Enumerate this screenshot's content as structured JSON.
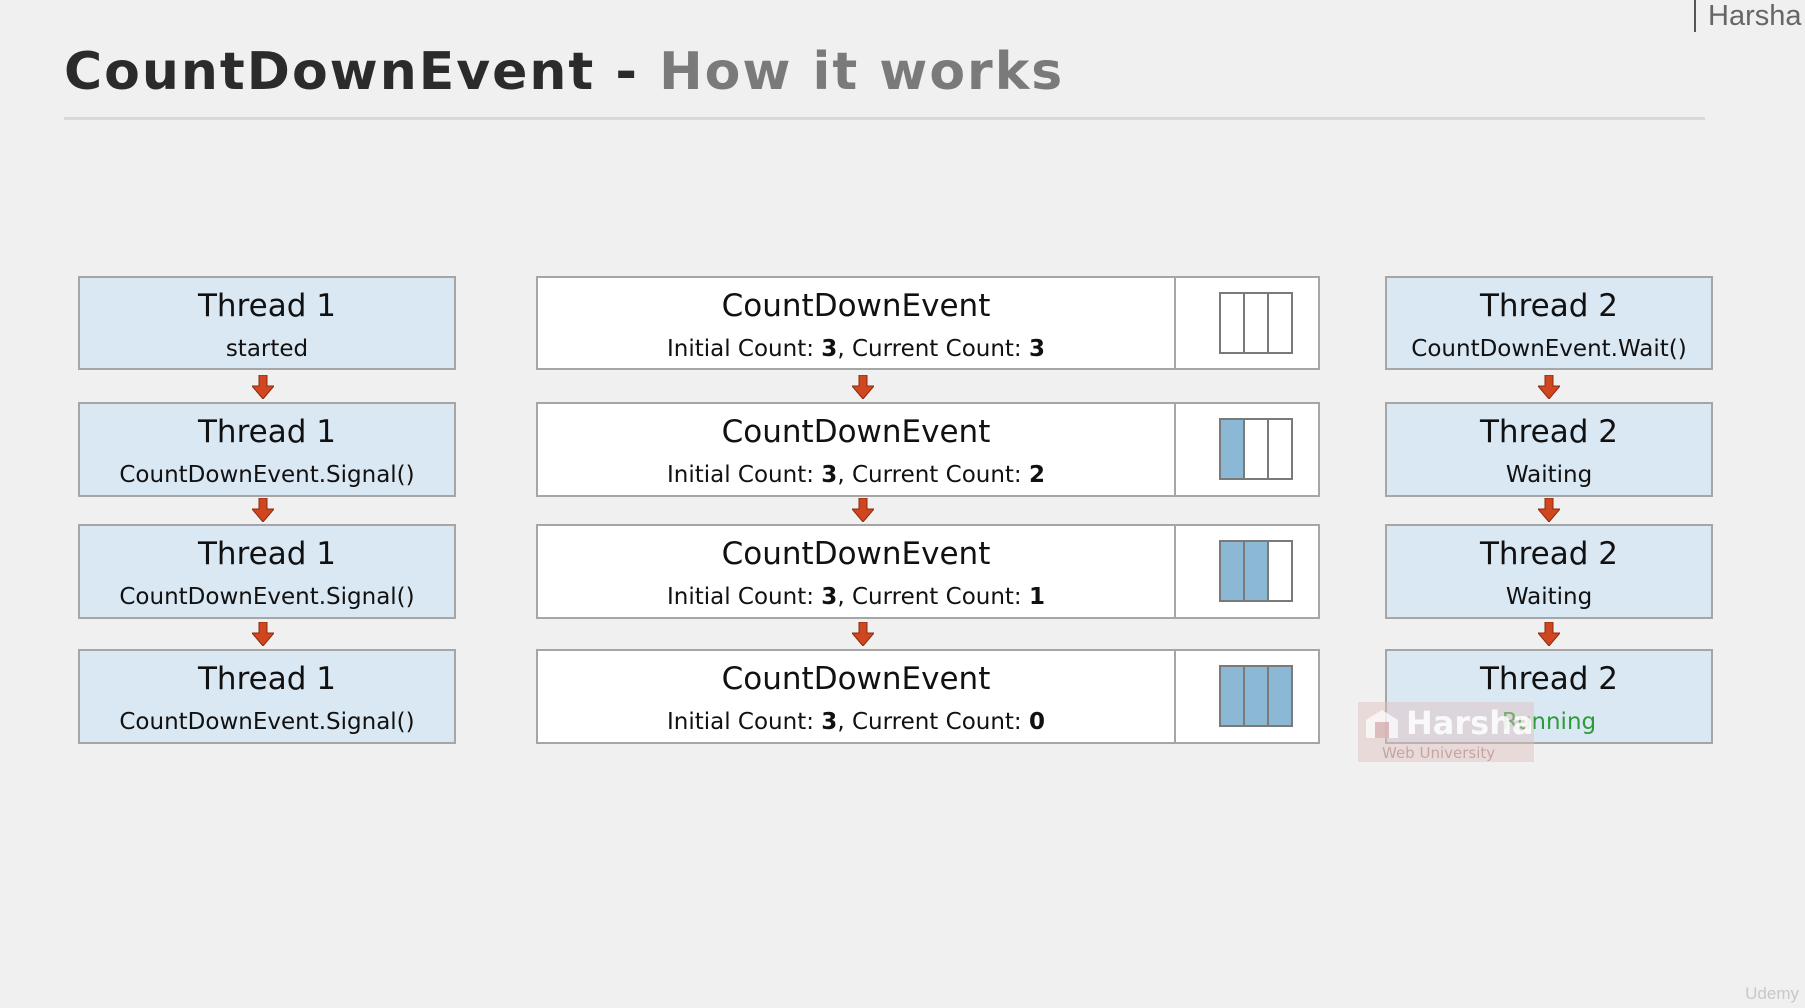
{
  "brand": "Harsha",
  "title": {
    "main": "CountDownEvent",
    "separator": "-",
    "subtitle": "How it works"
  },
  "thread1": [
    {
      "name": "Thread 1",
      "status": "started"
    },
    {
      "name": "Thread 1",
      "status": "CountDownEvent.Signal()"
    },
    {
      "name": "Thread 1",
      "status": "CountDownEvent.Signal()"
    },
    {
      "name": "Thread 1",
      "status": "CountDownEvent.Signal()"
    }
  ],
  "countdown": [
    {
      "name": "CountDownEvent",
      "initial_label": "Initial Count: ",
      "initial": "3",
      "sep": ", ",
      "current_label": "Current Count: ",
      "current": "3",
      "filled": 0,
      "slots": 3
    },
    {
      "name": "CountDownEvent",
      "initial_label": "Initial Count: ",
      "initial": "3",
      "sep": ", ",
      "current_label": "Current Count: ",
      "current": "2",
      "filled": 1,
      "slots": 3
    },
    {
      "name": "CountDownEvent",
      "initial_label": "Initial Count: ",
      "initial": "3",
      "sep": ", ",
      "current_label": "Current Count: ",
      "current": "1",
      "filled": 2,
      "slots": 3
    },
    {
      "name": "CountDownEvent",
      "initial_label": "Initial Count: ",
      "initial": "3",
      "sep": ", ",
      "current_label": "Current Count: ",
      "current": "0",
      "filled": 3,
      "slots": 3
    }
  ],
  "thread2": [
    {
      "name": "Thread 2",
      "status": "CountDownEvent.Wait()"
    },
    {
      "name": "Thread 2",
      "status": "Waiting"
    },
    {
      "name": "Thread 2",
      "status": "Waiting"
    },
    {
      "name": "Thread 2",
      "status": "Running"
    }
  ],
  "watermark": {
    "name": "Harsha",
    "sub": "Web University"
  },
  "footer": "Udemy",
  "colors": {
    "thread_box": "#dae8f4",
    "slot_filled": "#8bb8d4",
    "arrow": "#d0461e",
    "running": "#2e9b3a"
  }
}
